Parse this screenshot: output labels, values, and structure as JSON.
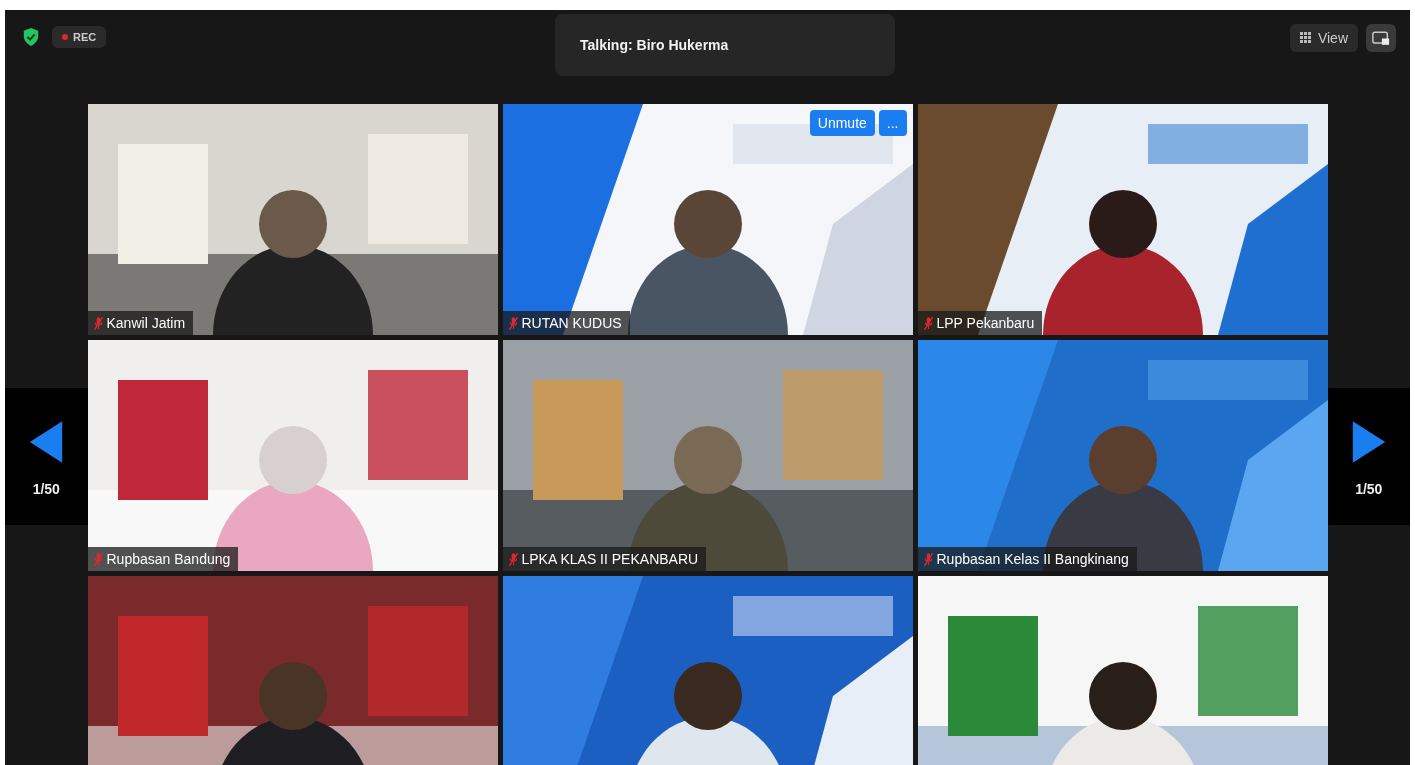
{
  "top_bar": {
    "recording": {
      "label": "REC"
    },
    "talking": "Talking: Biro Hukerma",
    "view_button": "View"
  },
  "nav": {
    "previous": {
      "page": "1/50"
    },
    "next": {
      "page": "1/50"
    }
  },
  "tiles": [
    {
      "kind": "picture",
      "name": "Kanwil Jatim",
      "muted": true
    },
    {
      "kind": "picture",
      "name": "RUTAN KUDUS",
      "muted": true,
      "hover_buttons": [
        "Unmute",
        "..."
      ]
    },
    {
      "kind": "picture",
      "name": "LPP Pekanbaru",
      "muted": true
    },
    {
      "kind": "picture",
      "name": "Rupbasan Bandung",
      "muted": true
    },
    {
      "kind": "picture",
      "name": "LPKA KLAS II PEKANBARU",
      "muted": true
    },
    {
      "kind": "picture",
      "name": "Rupbasan Kelas II Bangkinang",
      "muted": true
    },
    {
      "kind": "picture"
    },
    {
      "kind": "picture"
    },
    {
      "kind": "picture"
    }
  ]
}
